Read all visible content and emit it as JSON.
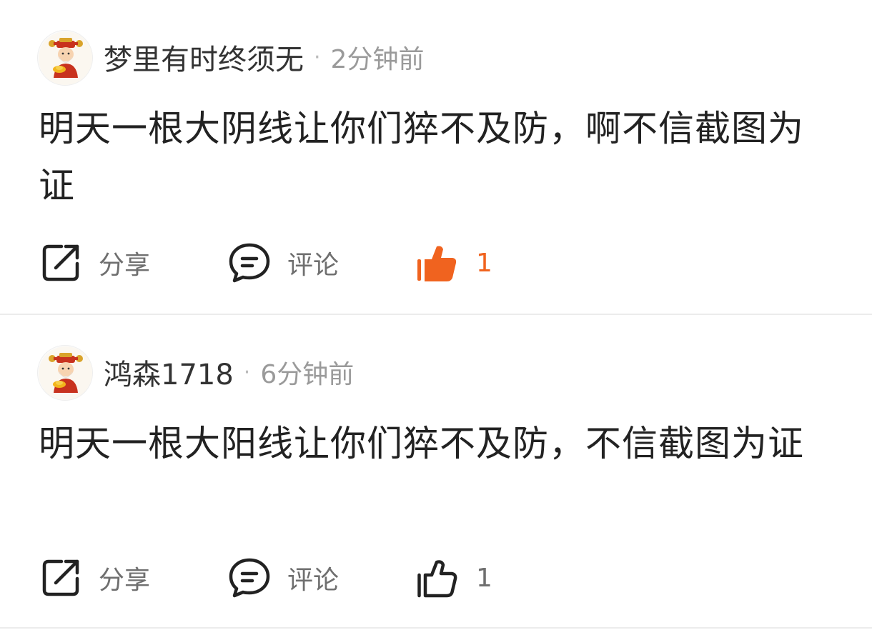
{
  "posts": [
    {
      "author": "梦里有时终须无",
      "separator": "·",
      "time": "2分钟前",
      "text": "明天一根大阴线让你们猝不及防，啊不信截图为证",
      "actions": {
        "share_label": "分享",
        "comment_label": "评论",
        "like_count": "1",
        "liked": true
      }
    },
    {
      "author": "鸿森1718",
      "separator": "·",
      "time": "6分钟前",
      "text": "明天一根大阳线让你们猝不及防，不信截图为证",
      "actions": {
        "share_label": "分享",
        "comment_label": "评论",
        "like_count": "1",
        "liked": false
      }
    }
  ],
  "icons": {
    "share": "share-icon",
    "comment": "comment-icon",
    "like": "thumbs-up-icon",
    "avatar": "fortune-god-avatar"
  },
  "colors": {
    "liked": "#f0631f",
    "text": "#222222",
    "muted": "#9a9a9a",
    "divider": "#ececec"
  }
}
